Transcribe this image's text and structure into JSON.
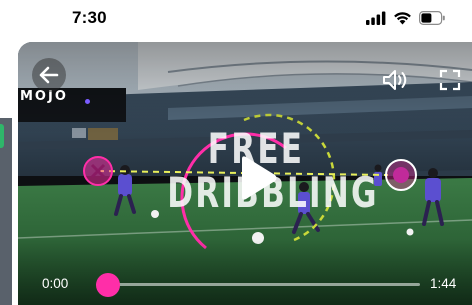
{
  "status_bar": {
    "time": "7:30",
    "icons": [
      "cellular-signal-icon",
      "wifi-icon",
      "battery-icon"
    ]
  },
  "video": {
    "brand": "MOJO",
    "title_line1": "FREE",
    "title_line2": "DRIBBLING",
    "controls": {
      "current_time": "0:00",
      "total_time": "1:44",
      "progress": 0
    },
    "icons": {
      "back": "back-arrow-icon",
      "sound": "speaker-sound-icon",
      "fullscreen": "fullscreen-icon",
      "play": "play-icon"
    },
    "colors": {
      "accent": "#ff2ea8",
      "pitch": "#2f6a3c",
      "player_kit": "#5b4fd0"
    }
  }
}
